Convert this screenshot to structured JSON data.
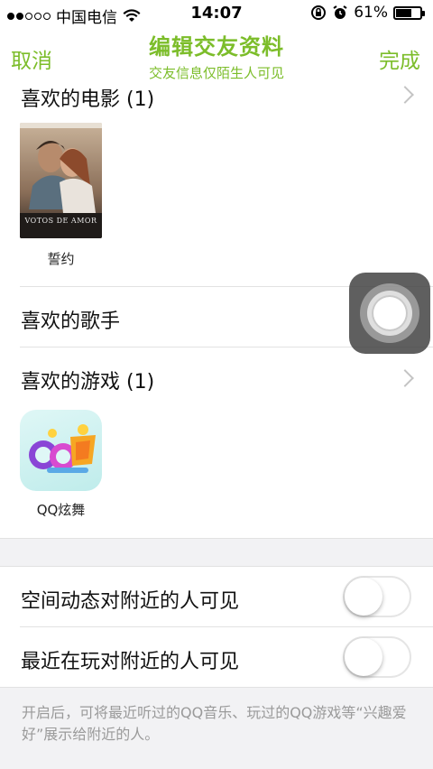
{
  "status_bar": {
    "signal_dots_filled": 2,
    "signal_dots_total": 5,
    "carrier": "中国电信",
    "time": "14:07",
    "battery": "61%",
    "battery_level": 0.61
  },
  "nav": {
    "cancel_label": "取消",
    "title": "编辑交友资料",
    "subtitle": "交友信息仅陌生人可见",
    "done_label": "完成"
  },
  "movies": {
    "header": "喜欢的电影 (1)",
    "items": [
      {
        "title": "誓约",
        "poster_text": "VOTOS DE AMOR"
      }
    ]
  },
  "singers": {
    "header": "喜欢的歌手"
  },
  "games": {
    "header": "喜欢的游戏 (1)",
    "items": [
      {
        "title": "QQ炫舞"
      }
    ]
  },
  "privacy": {
    "space_label": "空间动态对附近的人可见",
    "space_enabled": false,
    "playing_label": "最近在玩对附近的人可见",
    "playing_enabled": false,
    "footnote": "开启后，可将最近听过的QQ音乐、玩过的QQ游戏等“兴趣爱好”展示给附近的人。"
  },
  "colors": {
    "accent": "#7cbd2a",
    "separator": "#e2e2e2",
    "section_bg": "#f2f2f4"
  }
}
